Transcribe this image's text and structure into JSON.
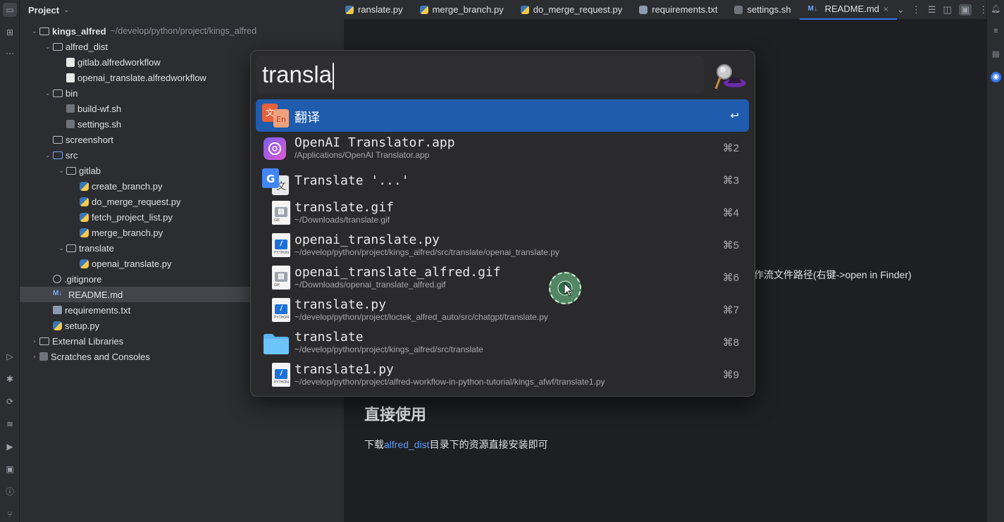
{
  "project_panel": {
    "title": "Project",
    "tree": [
      {
        "label": "kings_alfred",
        "path": "~/develop/python/project/kings_alfred",
        "icon": "folder-icon",
        "level": 0,
        "expanded": true,
        "bold": true
      },
      {
        "label": "alfred_dist",
        "icon": "folder-icon",
        "level": 1,
        "expanded": true
      },
      {
        "label": "gitlab.alfredworkflow",
        "icon": "workflow-file-icon",
        "level": 2
      },
      {
        "label": "openai_translate.alfredworkflow",
        "icon": "workflow-file-icon",
        "level": 2
      },
      {
        "label": "bin",
        "icon": "folder-icon",
        "level": 1,
        "expanded": true
      },
      {
        "label": "build-wf.sh",
        "icon": "shell-file-icon",
        "level": 2
      },
      {
        "label": "settings.sh",
        "icon": "shell-file-icon",
        "level": 2
      },
      {
        "label": "screenshort",
        "icon": "folder-icon",
        "level": 1
      },
      {
        "label": "src",
        "icon": "source-folder-icon",
        "level": 1,
        "expanded": true
      },
      {
        "label": "gitlab",
        "icon": "folder-icon",
        "level": 2,
        "expanded": true
      },
      {
        "label": "create_branch.py",
        "icon": "python-file-icon",
        "level": 3
      },
      {
        "label": "do_merge_request.py",
        "icon": "python-file-icon",
        "level": 3
      },
      {
        "label": "fetch_project_list.py",
        "icon": "python-file-icon",
        "level": 3
      },
      {
        "label": "merge_branch.py",
        "icon": "python-file-icon",
        "level": 3
      },
      {
        "label": "translate",
        "icon": "folder-icon",
        "level": 2,
        "expanded": true
      },
      {
        "label": "openai_translate.py",
        "icon": "python-file-icon",
        "level": 3
      },
      {
        "label": ".gitignore",
        "icon": "gitignore-icon",
        "level": 1
      },
      {
        "label": "README.md",
        "icon": "markdown-icon",
        "level": 1,
        "selected": true
      },
      {
        "label": "requirements.txt",
        "icon": "text-file-icon",
        "level": 1
      },
      {
        "label": "setup.py",
        "icon": "python-file-icon",
        "level": 1
      },
      {
        "label": "External Libraries",
        "icon": "library-icon",
        "level": 0,
        "collapsed": true
      },
      {
        "label": "Scratches and Consoles",
        "icon": "scratches-icon",
        "level": 0,
        "collapsed": true
      }
    ]
  },
  "tabs": [
    {
      "label": "ranslate.py",
      "icon": "python-file-icon"
    },
    {
      "label": "merge_branch.py",
      "icon": "python-file-icon"
    },
    {
      "label": "do_merge_request.py",
      "icon": "python-file-icon"
    },
    {
      "label": "requirements.txt",
      "icon": "text-file-icon"
    },
    {
      "label": "settings.sh",
      "icon": "shell-file-icon"
    },
    {
      "label": "README.md",
      "icon": "markdown-icon",
      "active": true,
      "close": "×"
    }
  ],
  "editor": {
    "partial_line": "作流文件路径(右键->open in Finder)",
    "heading": "直接使用",
    "para_prefix": "下载",
    "para_link": "alfred_dist",
    "para_suffix": "目录下的资源直接安装即可"
  },
  "alfred": {
    "query": "transla",
    "results": [
      {
        "title": "翻译",
        "subtitle": "",
        "shortcut": "↩",
        "icon": "translate-icon",
        "selected": true
      },
      {
        "title": "OpenAI Translator.app",
        "subtitle": "/Applications/OpenAI Translator.app",
        "shortcut": "⌘2",
        "icon": "openai-icon"
      },
      {
        "title": "Translate '...'",
        "subtitle": "",
        "shortcut": "⌘3",
        "icon": "google-translate-icon"
      },
      {
        "title": "translate.gif",
        "subtitle": "~/Downloads/translate.gif",
        "shortcut": "⌘4",
        "icon": "gif-file-icon"
      },
      {
        "title": "openai_translate.py",
        "subtitle": "~/develop/python/project/kings_alfred/src/translate/openai_translate.py",
        "shortcut": "⌘5",
        "icon": "python-doc-icon"
      },
      {
        "title": "openai_translate_alfred.gif",
        "subtitle": "~/Downloads/openai_translate_alfred.gif",
        "shortcut": "⌘6",
        "icon": "gif-file-icon"
      },
      {
        "title": "translate.py",
        "subtitle": "~/develop/python/project/loctek_alfred_auto/src/chatgpt/translate.py",
        "shortcut": "⌘7",
        "icon": "python-doc-icon"
      },
      {
        "title": "translate",
        "subtitle": "~/develop/python/project/kings_alfred/src/translate",
        "shortcut": "⌘8",
        "icon": "folder-icon"
      },
      {
        "title": "translate1.py",
        "subtitle": "~/develop/python/project/alfred-workflow-in-python-tutorial/kings_afwf/translate1.py",
        "shortcut": "⌘9",
        "icon": "python-doc-icon"
      }
    ]
  },
  "colors": {
    "accent": "#3574f0",
    "selection": "#1f5cad",
    "link": "#589df6"
  }
}
